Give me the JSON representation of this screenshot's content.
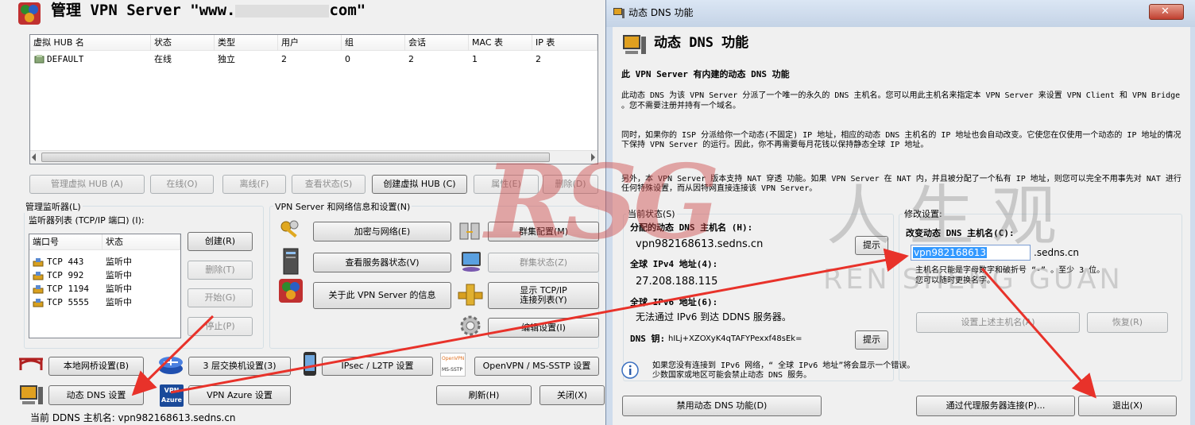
{
  "main": {
    "title": "管理 VPN Server \"www.",
    "title_tail": "com\"",
    "table": {
      "headers": [
        "虚拟 HUB 名",
        "状态",
        "类型",
        "用户",
        "组",
        "会话",
        "MAC 表",
        "IP 表"
      ],
      "rows": [
        [
          "DEFAULT",
          "在线",
          "独立",
          "2",
          "0",
          "2",
          "1",
          "2"
        ]
      ]
    },
    "hub_buttons": [
      "管理虚拟 HUB (A)",
      "在线(O)",
      "离线(F)",
      "查看状态(S)",
      "创建虚拟 HUB (C)",
      "属性(E)",
      "删除(D)"
    ],
    "listener": {
      "group_label": "管理监听器(L)",
      "list_label": "监听器列表 (TCP/IP 端口) (I):",
      "headers": [
        "端口号",
        "状态"
      ],
      "rows": [
        [
          "TCP 443",
          "监听中"
        ],
        [
          "TCP 992",
          "监听中"
        ],
        [
          "TCP 1194",
          "监听中"
        ],
        [
          "TCP 5555",
          "监听中"
        ]
      ],
      "buttons": [
        "创建(R)",
        "删除(T)",
        "开始(G)",
        "停止(P)"
      ]
    },
    "info": {
      "group_label": "VPN Server 和网络信息和设置(N)",
      "buttons": [
        "加密与网络(E)",
        "查看服务器状态(V)",
        "关于此 VPN Server 的信息",
        "群集配置(M)",
        "群集状态(Z)",
        "显示 TCP/IP 连接列表(Y)",
        "编辑设置(I)"
      ]
    },
    "bottom_buttons": [
      "本地网桥设置(B)",
      "3 层交换机设置(3)",
      "IPsec / L2TP 设置",
      "OpenVPN / MS-SSTP 设置",
      "动态 DNS 设置",
      "VPN Azure 设置",
      "刷新(H)",
      "关闭(X)"
    ],
    "icon_labels": {
      "openvpn": "OpenVPN",
      "mssstp": "MS-SSTP",
      "vpn": "VPN",
      "azure": "Azure"
    },
    "status_bar": "当前 DDNS 主机名:  vpn982168613.sedns.cn"
  },
  "dialog": {
    "titlebar": "动态 DNS 功能",
    "header": "动态 DNS 功能",
    "intro_title": "此 VPN Server 有内建的动态 DNS 功能",
    "p1": "此动态 DNS 为该 VPN Server 分派了一个唯一的永久的 DNS 主机名。您可以用此主机名来指定本 VPN Server 来设置 VPN Client 和 VPN Bridge 。您不需要注册并持有一个域名。",
    "p2": "同时，如果你的 ISP 分派给你一个动态(不固定) IP 地址，相应的动态 DNS 主机名的 IP 地址也会自动改变。它使您在仅使用一个动态的 IP 地址的情况下保持 VPN Server 的运行。因此，你不再需要每月花钱以保持静态全球 IP 地址。",
    "p3": "另外，本 VPN Server 版本支持 NAT 穿透 功能。如果 VPN Server 在 NAT 内，并且被分配了一个私有 IP 地址，则您可以完全不用事先对 NAT 进行任何特殊设置，而从因特网直接连接该 VPN Server。",
    "current": {
      "label": "当前状态(S)",
      "assigned_label": "分配的动态 DNS 主机名 (H):",
      "assigned_value": "vpn982168613.sedns.cn",
      "ipv4_label": "全球 IPv4 地址(4):",
      "ipv4_value": "27.208.188.115",
      "ipv6_label": "全球 IPv6 地址(6):",
      "ipv6_value": "无法通过 IPv6 到达 DDNS 服务器。",
      "key_label": "DNS 钥:",
      "key_value": "hILj+XZOXyK4qTAFYPexxf48sEk=",
      "hint_button": "提示"
    },
    "modify": {
      "label": "修改设置:",
      "host_label": "改变动态 DNS 主机名(C):",
      "host_value": "vpn982168613",
      "suffix": ".sedns.cn",
      "note1": "主机名只能是字母数字和破折号 “-” 。至少 3 位。",
      "note2": "您可以随时更换名字。",
      "set_button": "设置上述主机名(A)",
      "restore_button": "恢复(R)"
    },
    "info1": "如果您没有连接到 IPv6 网络，“ 全球 IPv6 地址”将会显示一个错误。",
    "info2": "少数国家或地区可能会禁止动态 DNS 服务。",
    "disable_button": "禁用动态 DNS 功能(D)",
    "proxy_button": "通过代理服务器连接(P)...",
    "exit_button": "退出(X)"
  },
  "watermark": {
    "logo": "RSG",
    "cn": "人生观",
    "en": "REN SHENG GUAN"
  }
}
